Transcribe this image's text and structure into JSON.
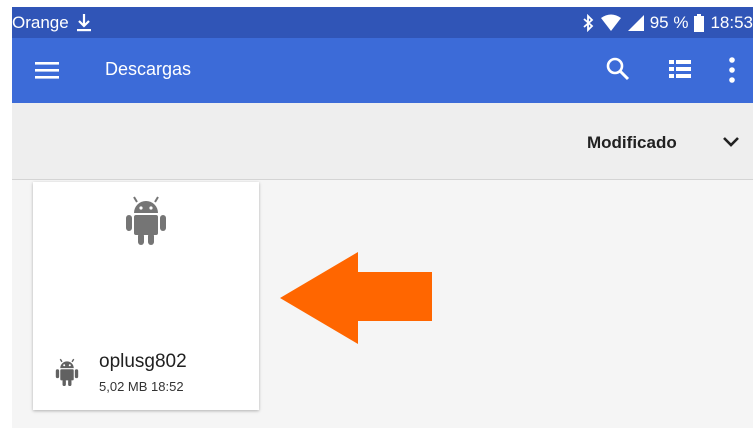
{
  "status_bar": {
    "carrier": "Orange",
    "battery": "95 %",
    "time": "18:53",
    "icons": [
      "download-icon",
      "bluetooth-icon",
      "wifi-icon",
      "signal-icon",
      "battery-icon"
    ]
  },
  "app_bar": {
    "title": "Descargas",
    "icons": [
      "menu-icon",
      "search-icon",
      "list-view-icon",
      "more-icon"
    ]
  },
  "sort": {
    "label": "Modificado",
    "icon": "chevron-down-icon"
  },
  "files": [
    {
      "name": "oplusg802",
      "meta": "5,02 MB 18:52",
      "icon": "android-icon"
    }
  ],
  "colors": {
    "status_bar": "#3055b7",
    "app_bar": "#3c6bd8",
    "arrow": "#ff6600"
  }
}
